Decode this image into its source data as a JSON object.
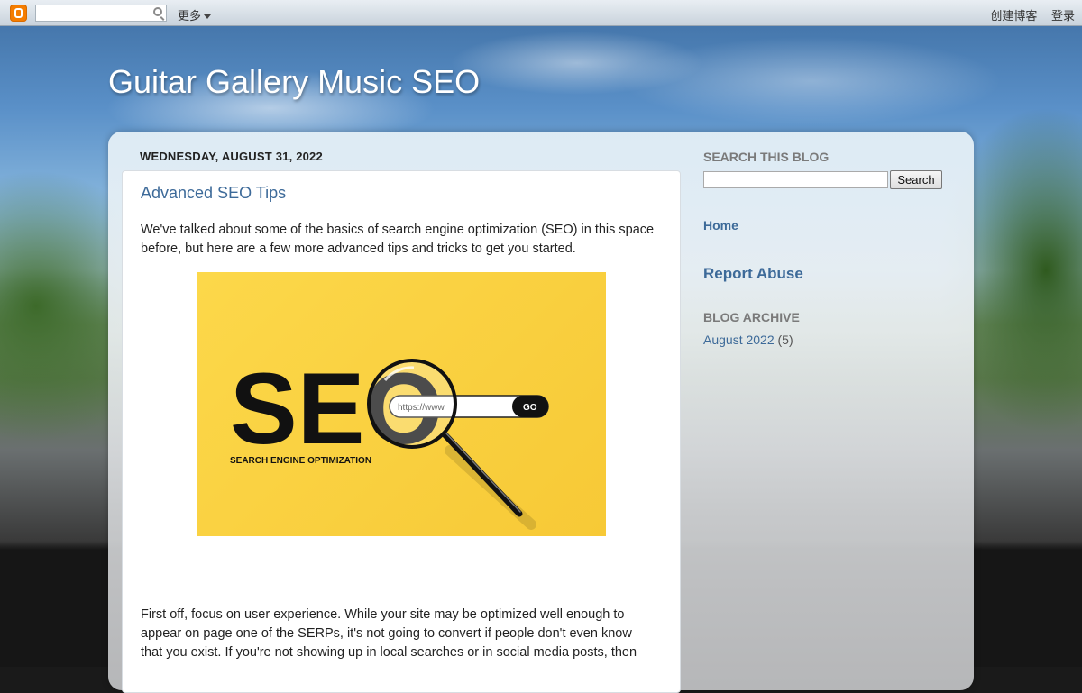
{
  "navbar": {
    "search_placeholder": "",
    "more_label": "更多",
    "create_blog": "创建博客",
    "sign_in": "登录"
  },
  "blog": {
    "title": "Guitar Gallery Music SEO"
  },
  "post": {
    "date": "WEDNESDAY, AUGUST 31, 2022",
    "title": "Advanced SEO Tips",
    "intro": "We've talked about some of the basics of search engine optimization (SEO) in this space before, but here are a few more advanced tips and tricks to get you started.",
    "body_1": "First off, focus on user experience. While your site may be optimized well enough to appear on page one of the SERPs, it's not going to convert if people don't even know that you exist. If you're not showing up in local searches or in social media posts, then",
    "image": {
      "big_text": "SEO",
      "caption": "SEARCH ENGINE OPTIMIZATION",
      "url_text": "https://www",
      "go_label": "GO"
    }
  },
  "sidebar": {
    "search_heading": "SEARCH THIS BLOG",
    "search_button": "Search",
    "home_link": "Home",
    "report_abuse": "Report Abuse",
    "archive_heading": "BLOG ARCHIVE",
    "archive_month": "August 2022",
    "archive_count": "(5)"
  },
  "colors": {
    "link": "#3d6a99",
    "image_bg": "#fcd84a"
  }
}
